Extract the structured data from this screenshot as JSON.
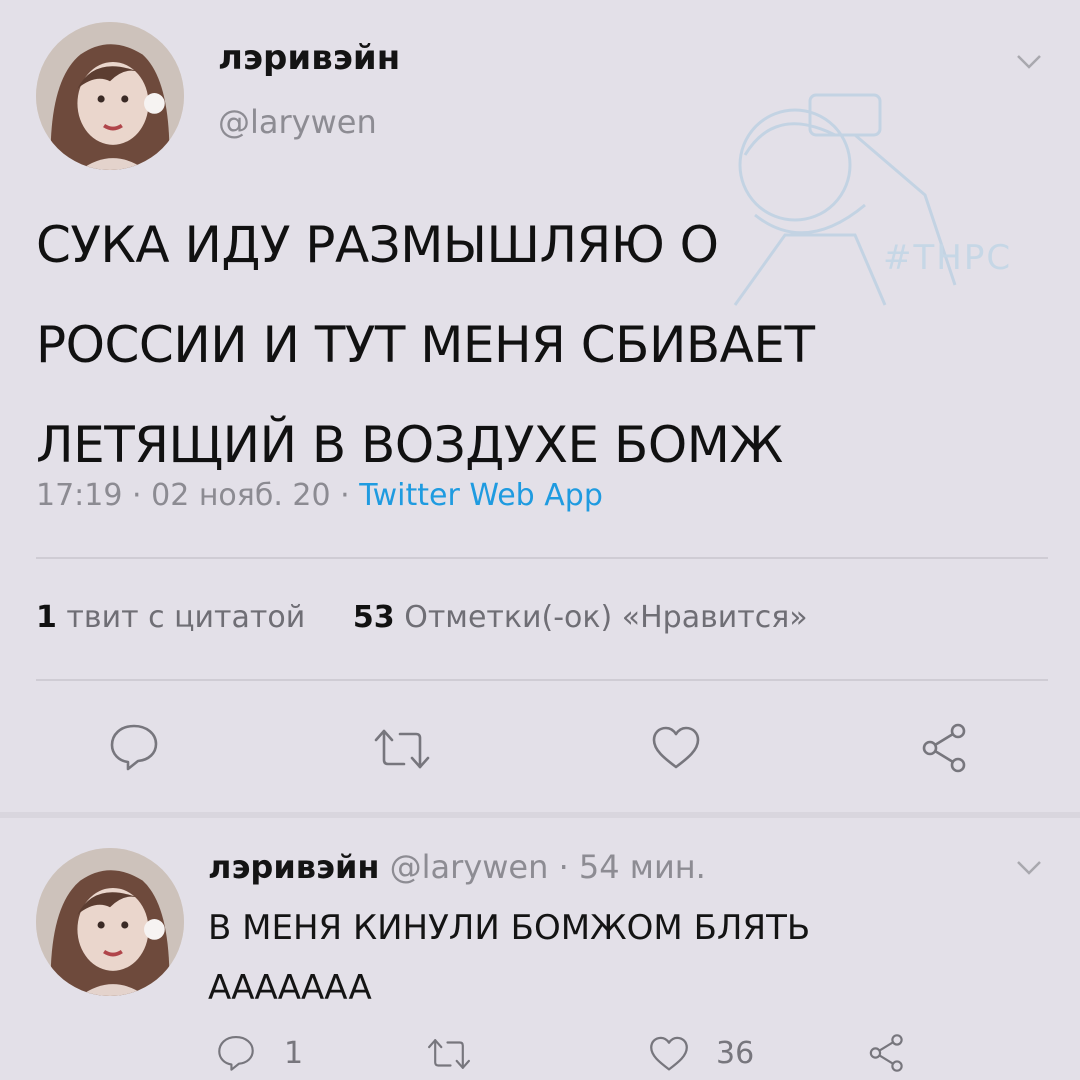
{
  "tweet": {
    "display_name": "лэривэйн",
    "handle": "@larywen",
    "text_lines": [
      "СУКА ИДУ РАЗМЫШЛЯЮ О",
      "РОССИИ И ТУТ МЕНЯ СБИВАЕТ",
      "ЛЕТЯЩИЙ В ВОЗДУХЕ БОМЖ"
    ],
    "time": "17:19",
    "date": "02 нояб. 20",
    "dot": "·",
    "source": "Twitter Web App",
    "quote_count": "1",
    "quote_label": "твит с цитатой",
    "like_count": "53",
    "like_label": "Отметки(-ок) «Нравится»"
  },
  "reply": {
    "display_name": "лэривэйн",
    "handle": "@larywen",
    "dot": "·",
    "time_ago": "54 мин.",
    "text_lines": [
      "В МЕНЯ КИНУЛИ БОМЖОМ БЛЯТЬ",
      "АААААAA"
    ],
    "reply_count": "1",
    "like_count": "36"
  },
  "watermark": {
    "text": "#THPC"
  },
  "icons": [
    "chevron-down-icon",
    "reply-icon",
    "retweet-icon",
    "heart-icon",
    "share-icon"
  ],
  "colors": {
    "background": "#e3e0e8",
    "link": "#1f9be0",
    "muted": "#8c8b92"
  }
}
